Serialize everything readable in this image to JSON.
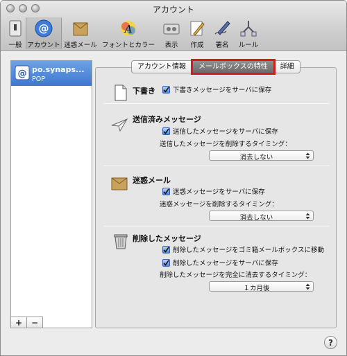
{
  "window": {
    "title": "アカウント"
  },
  "toolbar": {
    "items": [
      {
        "label": "一般",
        "icon": "general-switch-icon"
      },
      {
        "label": "アカウント",
        "icon": "at-sign-icon"
      },
      {
        "label": "迷惑メール",
        "icon": "junk-mail-icon"
      },
      {
        "label": "フォントとカラー",
        "icon": "font-color-icon"
      },
      {
        "label": "表示",
        "icon": "viewing-icon"
      },
      {
        "label": "作成",
        "icon": "compose-pencil-icon"
      },
      {
        "label": "署名",
        "icon": "signature-pen-icon"
      },
      {
        "label": "ルール",
        "icon": "rules-icon"
      }
    ],
    "active_index": 1
  },
  "sidebar": {
    "account": {
      "name": "po.synaps...",
      "type": "POP",
      "icon": "at-sign-icon"
    },
    "add_label": "+",
    "remove_label": "−"
  },
  "tabs": {
    "account_info": "アカウント情報",
    "mailbox_behaviors": "メールボックスの特性",
    "advanced": "詳細",
    "selected": "mailbox_behaviors",
    "highlight_color": "#d61919"
  },
  "drafts": {
    "title": "下書き",
    "store_on_server": "下書きメッセージをサーバに保存",
    "store_checked": true
  },
  "sent": {
    "title": "送信済みメッセージ",
    "store_on_server": "送信したメッセージをサーバに保存",
    "store_checked": true,
    "delete_label": "送信したメッセージを削除するタイミング：",
    "delete_value": "消去しない"
  },
  "junk": {
    "title": "迷惑メール",
    "store_on_server": "迷惑メッセージをサーバに保存",
    "store_checked": true,
    "delete_label": "迷惑メッセージを削除するタイミング：",
    "delete_value": "消去しない"
  },
  "trash": {
    "title": "削除したメッセージ",
    "move_to_trash": "削除したメッセージをゴミ箱メールボックスに移動",
    "move_checked": true,
    "store_on_server": "削除したメッセージをサーバに保存",
    "store_checked": true,
    "erase_label": "削除したメッセージを完全に消去するタイミング：",
    "erase_value": "１カ月後"
  },
  "help": {
    "label": "?"
  }
}
